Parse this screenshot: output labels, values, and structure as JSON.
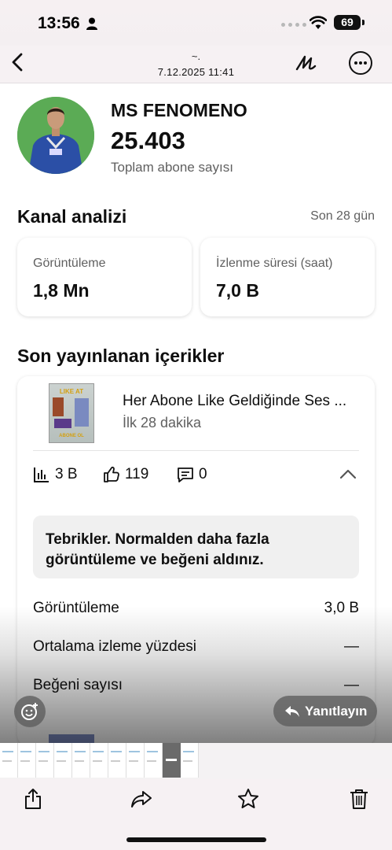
{
  "status_bar": {
    "time": "13:56",
    "battery": "69"
  },
  "photo_header": {
    "subtitle": "~.",
    "date": "7.12.2025 11:41"
  },
  "channel": {
    "name": "MS FENOMENO",
    "subscribers": "25.403",
    "subscribers_label": "Toplam abone sayısı"
  },
  "analytics": {
    "title": "Kanal analizi",
    "period": "Son 28 gün",
    "metrics": [
      {
        "label": "Görüntüleme",
        "value": "1,8 Mn"
      },
      {
        "label": "İzlenme süresi (saat)",
        "value": "7,0 B"
      }
    ]
  },
  "recent": {
    "title": "Son yayınlanan içerikler",
    "video": {
      "title": "Her Abone Like Geldiğinde Ses ...",
      "subtitle": "İlk 28 dakika",
      "thumb_text_top": "LIKE AT",
      "thumb_text_bottom": "ABONE OL",
      "views": "3 B",
      "likes": "119",
      "comments": "0"
    },
    "notice": "Tebrikler. Normalden daha fazla görüntüleme ve beğeni aldınız.",
    "rows": [
      {
        "label": "Görüntüleme",
        "value": "3,0 B"
      },
      {
        "label": "Ortalama izleme yüzdesi",
        "value": "—"
      },
      {
        "label": "Beğeni sayısı",
        "value": "—"
      }
    ]
  },
  "overlay": {
    "reply_label": "Yanıtlayın"
  },
  "icons": {
    "back": "chevron-left-icon",
    "markup": "markup-pen-icon",
    "more": "ellipsis-circle-icon",
    "views": "bar-chart-icon",
    "likes": "thumbs-up-icon",
    "comments": "comment-icon",
    "emoji": "emoji-add-icon",
    "reply": "reply-arrow-icon",
    "share": "share-icon",
    "forward": "forward-icon",
    "favorite": "star-icon",
    "delete": "trash-icon"
  }
}
